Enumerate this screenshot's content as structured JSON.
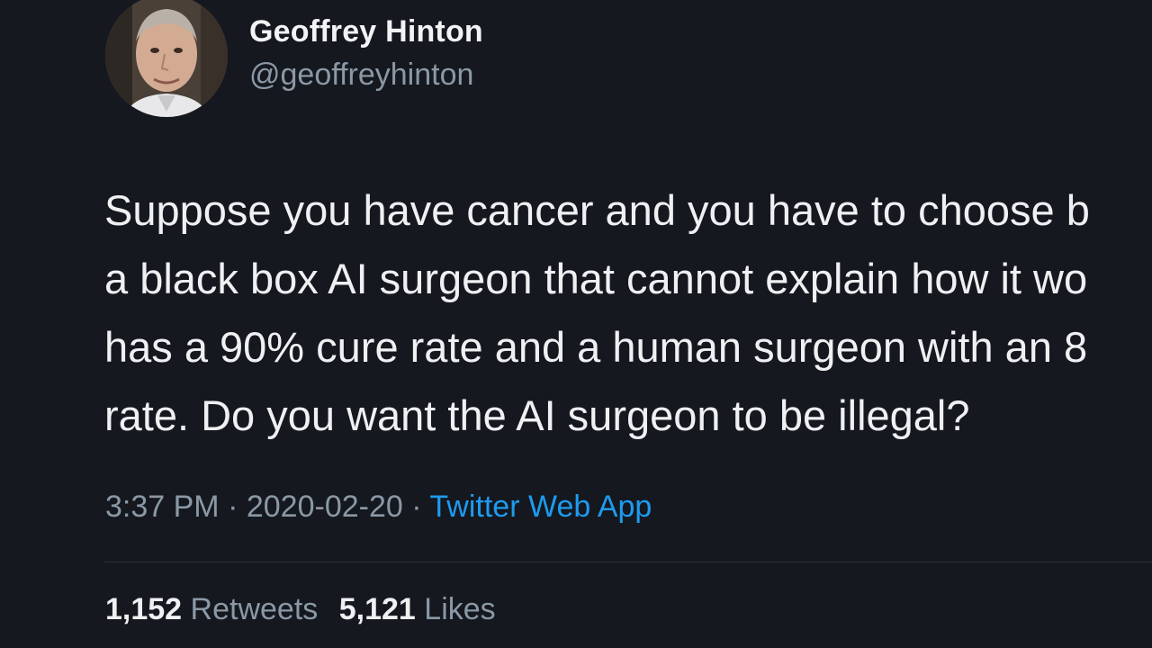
{
  "author": {
    "display_name": "Geoffrey Hinton",
    "handle": "@geoffreyhinton",
    "avatar_icon": "profile-photo"
  },
  "tweet": {
    "lines": [
      "Suppose you have cancer and you have to choose b",
      "a black box AI surgeon that cannot explain how it wo",
      "has a 90% cure rate and a human surgeon with an 8",
      "rate. Do you want the AI surgeon to be illegal?"
    ]
  },
  "meta": {
    "time": "3:37 PM",
    "separator": "·",
    "date": "2020-02-20",
    "source": "Twitter Web App"
  },
  "stats": {
    "retweets_count": "1,152",
    "retweets_label": "Retweets",
    "likes_count": "5,121",
    "likes_label": "Likes"
  },
  "colors": {
    "background": "#15181f",
    "link": "#1d9bf0",
    "secondary_text": "#8b98a5"
  }
}
